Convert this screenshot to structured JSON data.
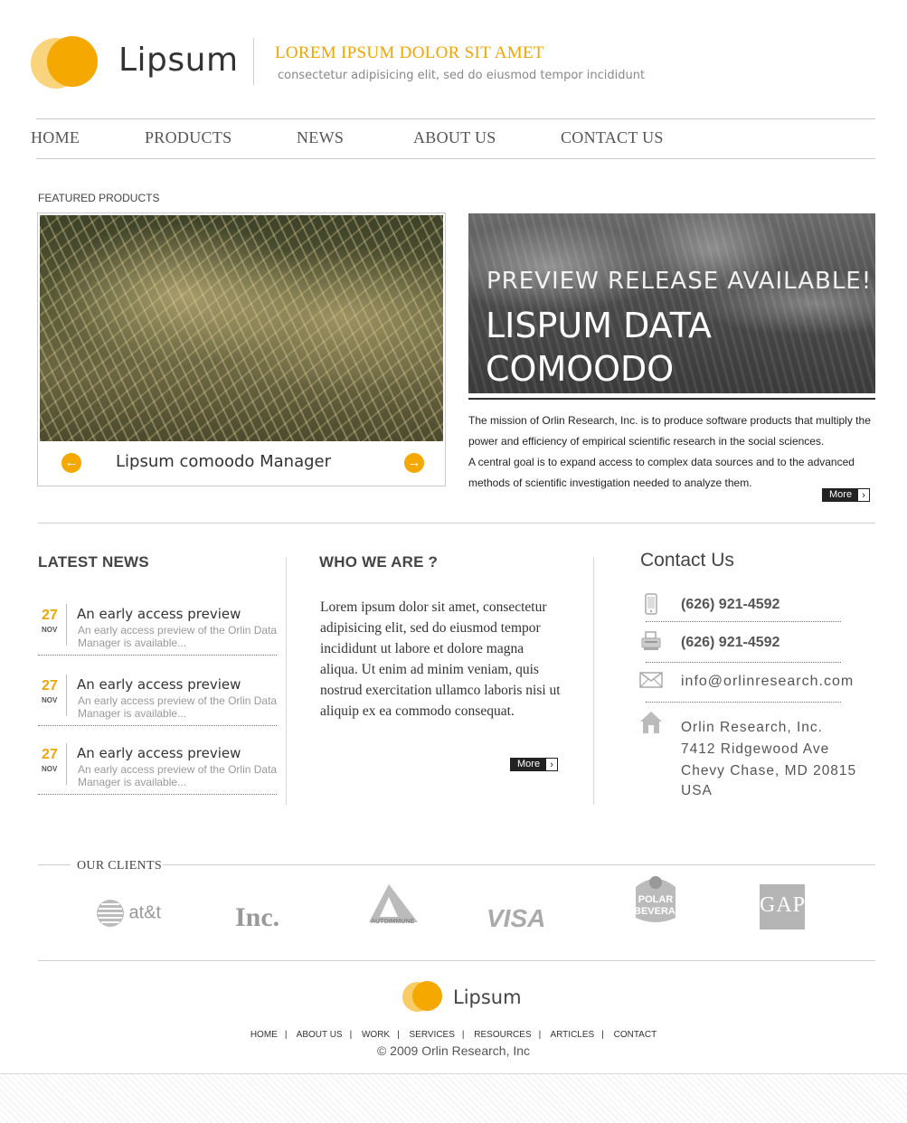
{
  "header": {
    "logo_text": "Lipsum",
    "tagline": "LOREM IPSUM DOLOR SIT AMET",
    "subtagline": "consectetur adipisicing elit, sed do eiusmod tempor incididunt"
  },
  "nav": {
    "items": [
      "HOME",
      "PRODUCTS",
      "NEWS",
      "ABOUT US",
      "CONTACT US"
    ]
  },
  "featured": {
    "label": "FEATURED PRODUCTS",
    "slider_caption": "Lipsum comoodo Manager",
    "prev_icon": "arrow-left",
    "next_icon": "arrow-right"
  },
  "promo": {
    "small_title": "PREVIEW RELEASE AVAILABLE!",
    "big_title": "LISPUM DATA COMOODO",
    "mission_1": "The mission of Orlin Research, Inc. is to produce software products that multiply the power and efficiency of empirical scientific research in the social sciences.",
    "mission_2": " A central goal is to expand access to complex data sources and to the advanced methods of scientific investigation needed to analyze them.",
    "more_label": "More"
  },
  "latest_news": {
    "title": "LATEST NEWS",
    "items": [
      {
        "day": "27",
        "month": "NOV",
        "title": "An early access preview",
        "desc": "An early access preview of the Orlin Data Manager is available..."
      },
      {
        "day": "27",
        "month": "NOV",
        "title": "An early access preview",
        "desc": "An early access preview of the Orlin Data Manager is available..."
      },
      {
        "day": "27",
        "month": "NOV",
        "title": "An early access preview",
        "desc": "An early access preview of the Orlin Data Manager is available..."
      }
    ]
  },
  "who": {
    "title": "WHO WE ARE ?",
    "text": "Lorem ipsum dolor sit amet, consectetur adipisicing elit, sed do eiusmod tempor incididunt ut labore et dolore magna aliqua. Ut enim ad minim veniam, quis nostrud exercitation ullamco laboris nisi ut aliquip ex ea commodo consequat.",
    "more_label": "More"
  },
  "contact": {
    "title": "Contact Us",
    "phone": "(626) 921-4592",
    "fax": "(626) 921-4592",
    "email": "info@orlinresearch.com",
    "address_1": "Orlin Research, Inc.",
    "address_2": "7412 Ridgewood Ave",
    "address_3": "Chevy Chase, MD 20815",
    "address_4": "USA"
  },
  "clients": {
    "label": "OUR CLIENTS",
    "logos": [
      "at&t",
      "Inc.",
      "AUTOIMMUNE",
      "VISA",
      "POLAR BEVERAGES",
      "GAP"
    ]
  },
  "footer": {
    "logo_text": "Lipsum",
    "links": [
      "HOME",
      "ABOUT US",
      "WORK",
      "SERVICES",
      "RESOURCES",
      "ARTICLES",
      "CONTACT"
    ],
    "copyright": "© 2009 Orlin Research, Inc"
  },
  "colors": {
    "accent": "#f5a800",
    "text": "#333333",
    "muted": "#999999"
  }
}
